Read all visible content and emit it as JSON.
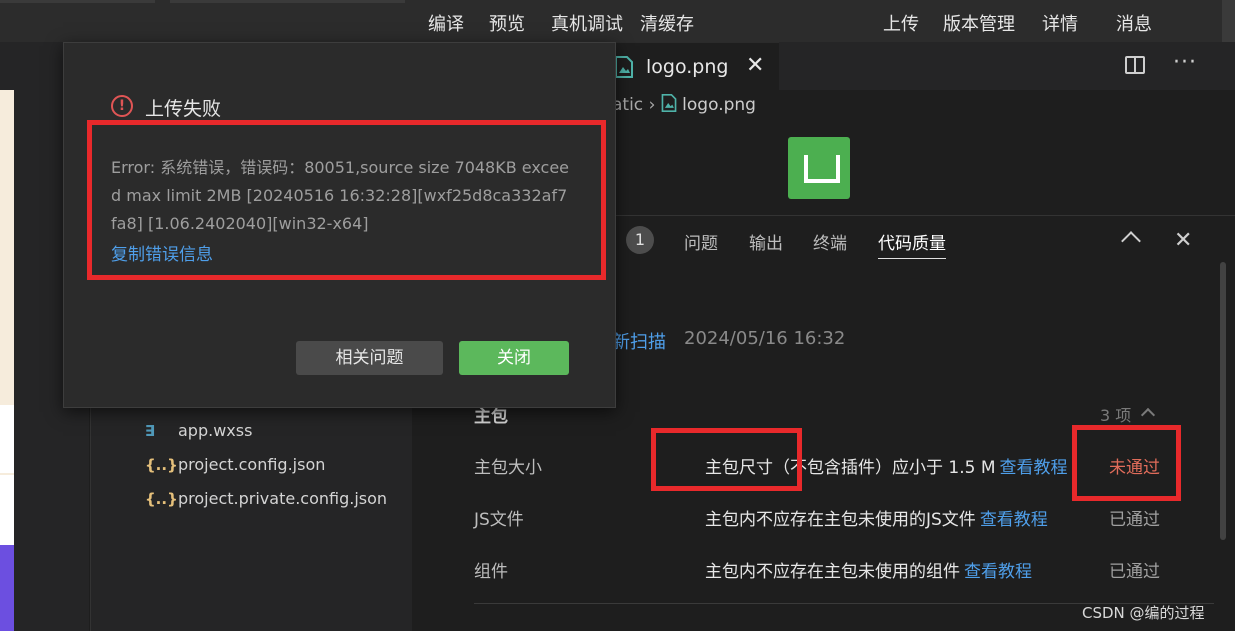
{
  "toolbar": {
    "compile": "编译",
    "preview": "预览",
    "real_device_debug": "真机调试",
    "clear_cache": "清缓存",
    "upload": "上传",
    "version_management": "版本管理",
    "details": "详情",
    "messages": "消息"
  },
  "editor": {
    "tab_name": "logo.png",
    "breadcrumb_prefix": "atic",
    "breadcrumb_file": "logo.png"
  },
  "explorer": {
    "files": [
      {
        "name": "app.wxss",
        "icon": "css-file-icon"
      },
      {
        "name": "project.config.json",
        "icon": "json-file-icon"
      },
      {
        "name": "project.private.config.json",
        "icon": "json-file-icon"
      }
    ]
  },
  "panel": {
    "badge": "1",
    "tabs": [
      "问题",
      "输出",
      "终端",
      "代码质量"
    ],
    "active_tab": "代码质量",
    "rescan_label": "新扫描",
    "scan_time": "2024/05/16 16:32",
    "main_package": {
      "title": "主包",
      "count": "3 项"
    },
    "rows": [
      {
        "name": "主包大小",
        "desc": "主包尺寸（不包含插件）应小于 1.5 M",
        "link": "查看教程",
        "status": "未通过",
        "status_type": "fail"
      },
      {
        "name": "JS文件",
        "desc": "主包内不应存在主包未使用的JS文件",
        "link": "查看教程",
        "status": "已通过",
        "status_type": "pass"
      },
      {
        "name": "组件",
        "desc": "主包内不应存在主包未使用的组件",
        "link": "查看教程",
        "status": "已通过",
        "status_type": "pass"
      }
    ]
  },
  "dialog": {
    "title": "上传失败",
    "message": "Error: 系统错误，错误码：80051,source size 7048KB exceed max limit 2MB [20240516 16:32:28][wxf25d8ca332af7fa8] [1.06.2402040][win32-x64]",
    "copy_link": "复制错误信息",
    "related_button": "相关问题",
    "close_button": "关闭"
  },
  "watermark": "CSDN @编的过程",
  "colors": {
    "error": "#e05555",
    "link": "#4f9fea",
    "primary_button": "#5cb85c",
    "annotation": "#e8292b"
  }
}
